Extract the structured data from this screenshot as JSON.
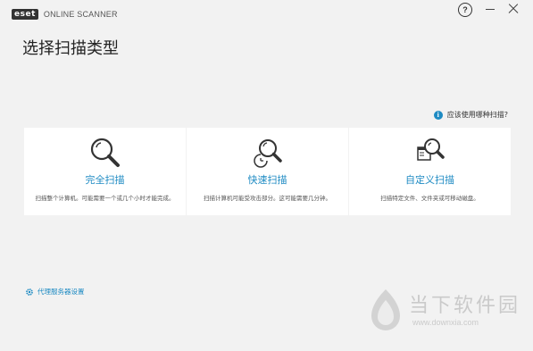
{
  "window": {
    "logo_badge": "eset",
    "product_name": "ONLINE SCANNER",
    "help_label": "?"
  },
  "page": {
    "title": "选择扫描类型",
    "hint": "应该使用哪种扫描?"
  },
  "scan_types": [
    {
      "icon": "magnifier-icon",
      "title": "完全扫描",
      "description": "扫描整个计算机。可能需要一个或几个小时才能完成。"
    },
    {
      "icon": "magnifier-clock-icon",
      "title": "快速扫描",
      "description": "扫描计算机可能受攻击部分。这可能需要几分钟。"
    },
    {
      "icon": "magnifier-window-icon",
      "title": "自定义扫描",
      "description": "扫描特定文件、文件夹或可移动磁盘。"
    }
  ],
  "footer": {
    "proxy_settings": "代理服务器设置"
  },
  "watermark": {
    "name": "当下软件园",
    "url": "www.downxia.com"
  },
  "colors": {
    "accent": "#1e8bc3",
    "background": "#f2f2f2",
    "card": "#ffffff"
  }
}
